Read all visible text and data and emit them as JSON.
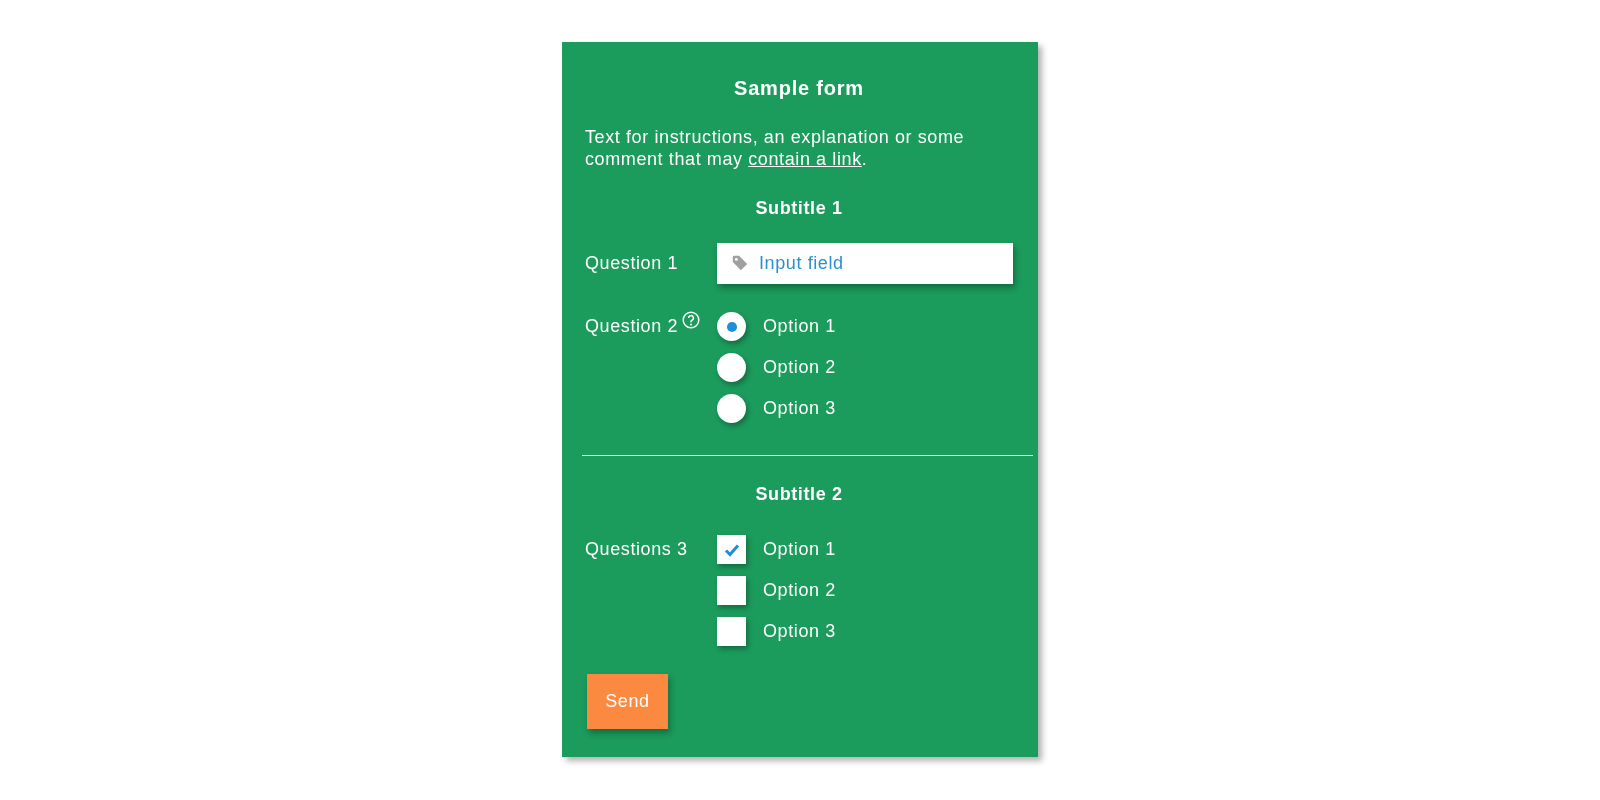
{
  "form": {
    "title": "Sample form",
    "intro": {
      "text_before": "Text for instructions, an explanation or some comment that may ",
      "link": "contain a link",
      "text_after": "."
    },
    "sections": [
      {
        "subtitle": "Subtitle 1",
        "questions": [
          {
            "kind": "input",
            "label": "Question 1",
            "placeholder": "Input field"
          },
          {
            "kind": "radio",
            "label": "Question 2",
            "help": true,
            "options": [
              {
                "label": "Option 1",
                "selected": true
              },
              {
                "label": "Option 2",
                "selected": false
              },
              {
                "label": "Option 3",
                "selected": false
              }
            ]
          }
        ]
      },
      {
        "subtitle": "Subtitle 2",
        "questions": [
          {
            "kind": "checkbox",
            "label": "Questions 3",
            "options": [
              {
                "label": "Option 1",
                "checked": true
              },
              {
                "label": "Option 2",
                "checked": false
              },
              {
                "label": "Option 3",
                "checked": false
              }
            ]
          }
        ]
      }
    ],
    "submit": "Send"
  }
}
